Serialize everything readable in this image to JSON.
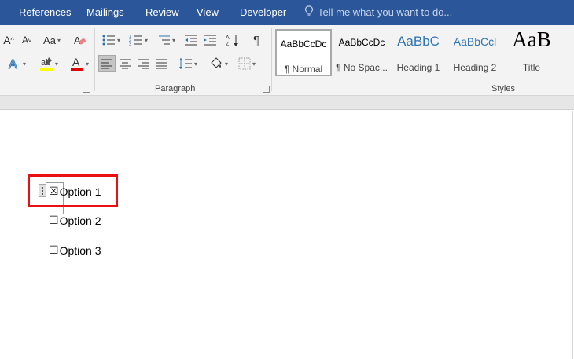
{
  "tabs": [
    "References",
    "Mailings",
    "Review",
    "View",
    "Developer"
  ],
  "tell_me": "Tell me what you want to do...",
  "ribbon": {
    "groups": {
      "paragraph": "Paragraph",
      "styles": "Styles"
    }
  },
  "styles": [
    {
      "sample": "AaBbCcDc",
      "name": "¶ Normal"
    },
    {
      "sample": "AaBbCcDc",
      "name": "¶ No Spac..."
    },
    {
      "sample": "AaBbC",
      "name": "Heading 1"
    },
    {
      "sample": "AaBbCcl",
      "name": "Heading 2"
    },
    {
      "sample": "AaB",
      "name": "Title"
    }
  ],
  "document": {
    "options": [
      {
        "box": "☒",
        "label": "Option 1"
      },
      {
        "box": "☐",
        "label": "Option 2"
      },
      {
        "box": "☐",
        "label": "Option 3"
      }
    ]
  },
  "colors": {
    "tabbar": "#2b579a",
    "highlight": "#e81010",
    "heading": "#2e74b5"
  }
}
